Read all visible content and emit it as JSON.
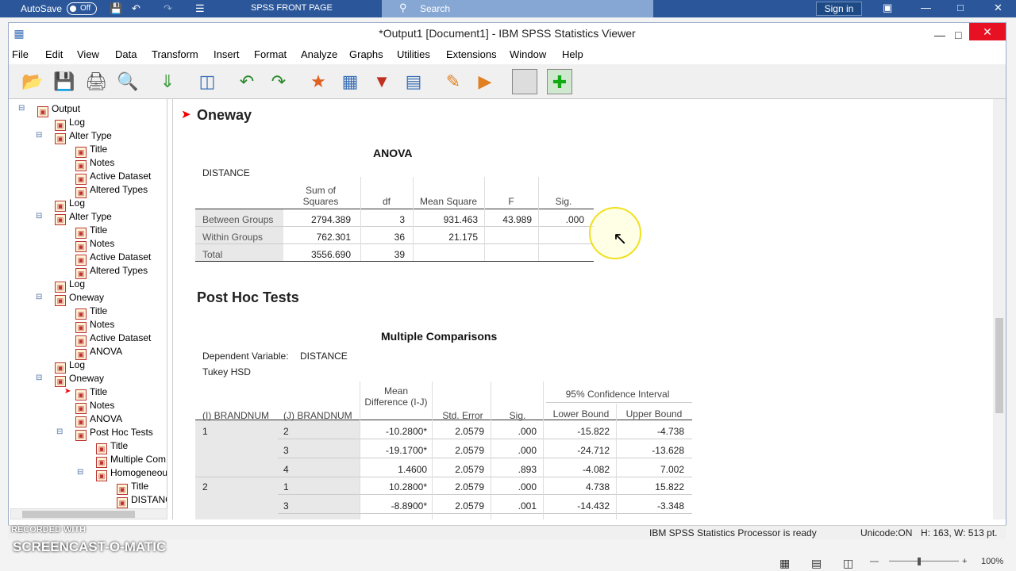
{
  "word": {
    "autosave": "AutoSave",
    "toggle": "Off",
    "doc_name": "SPSS FRONT PAGE",
    "search": "Search",
    "signin": "Sign in"
  },
  "window": {
    "title": "*Output1 [Document1] - IBM SPSS Statistics Viewer"
  },
  "menu": [
    "File",
    "Edit",
    "View",
    "Data",
    "Transform",
    "Insert",
    "Format",
    "Analyze",
    "Graphs",
    "Utilities",
    "Extensions",
    "Window",
    "Help"
  ],
  "outline": [
    {
      "label": "Output"
    },
    {
      "label": "Log"
    },
    {
      "label": "Alter Type"
    },
    {
      "label": "Title"
    },
    {
      "label": "Notes"
    },
    {
      "label": "Active Dataset"
    },
    {
      "label": "Altered Types"
    },
    {
      "label": "Log"
    },
    {
      "label": "Alter Type"
    },
    {
      "label": "Title"
    },
    {
      "label": "Notes"
    },
    {
      "label": "Active Dataset"
    },
    {
      "label": "Altered Types"
    },
    {
      "label": "Log"
    },
    {
      "label": "Oneway"
    },
    {
      "label": "Title"
    },
    {
      "label": "Notes"
    },
    {
      "label": "Active Dataset"
    },
    {
      "label": "ANOVA"
    },
    {
      "label": "Log"
    },
    {
      "label": "Oneway"
    },
    {
      "label": "Title"
    },
    {
      "label": "Notes"
    },
    {
      "label": "ANOVA"
    },
    {
      "label": "Post Hoc Tests"
    },
    {
      "label": "Title"
    },
    {
      "label": "Multiple Com"
    },
    {
      "label": "Homogeneou"
    },
    {
      "label": "Title"
    },
    {
      "label": "DISTANC"
    }
  ],
  "content": {
    "oneway": "Oneway",
    "anova_title": "ANOVA",
    "anova_var": "DISTANCE",
    "anova_headers": {
      "ss": "Sum of Squares",
      "df": "df",
      "ms": "Mean Square",
      "f": "F",
      "sig": "Sig."
    },
    "anova_rows": [
      {
        "label": "Between Groups",
        "ss": "2794.389",
        "df": "3",
        "ms": "931.463",
        "f": "43.989",
        "sig": ".000"
      },
      {
        "label": "Within Groups",
        "ss": "762.301",
        "df": "36",
        "ms": "21.175",
        "f": "",
        "sig": ""
      },
      {
        "label": "Total",
        "ss": "3556.690",
        "df": "39",
        "ms": "",
        "f": "",
        "sig": ""
      }
    ],
    "posthoc": "Post Hoc Tests",
    "mc_title": "Multiple Comparisons",
    "mc_depvar_label": "Dependent Variable:",
    "mc_depvar": "DISTANCE",
    "mc_method": "Tukey HSD",
    "mc_headers": {
      "i": "(I) BRANDNUM",
      "j": "(J) BRANDNUM",
      "md": "Mean Difference (I-J)",
      "se": "Std. Error",
      "sig": "Sig.",
      "ci": "95% Confidence Interval",
      "lb": "Lower Bound",
      "ub": "Upper Bound"
    },
    "mc_rows": [
      {
        "i": "1",
        "j": "2",
        "md": "-10.2800*",
        "se": "2.0579",
        "sig": ".000",
        "lb": "-15.822",
        "ub": "-4.738"
      },
      {
        "i": "",
        "j": "3",
        "md": "-19.1700*",
        "se": "2.0579",
        "sig": ".000",
        "lb": "-24.712",
        "ub": "-13.628"
      },
      {
        "i": "",
        "j": "4",
        "md": "1.4600",
        "se": "2.0579",
        "sig": ".893",
        "lb": "-4.082",
        "ub": "7.002"
      },
      {
        "i": "2",
        "j": "1",
        "md": "10.2800*",
        "se": "2.0579",
        "sig": ".000",
        "lb": "4.738",
        "ub": "15.822"
      },
      {
        "i": "",
        "j": "3",
        "md": "-8.8900*",
        "se": "2.0579",
        "sig": ".001",
        "lb": "-14.432",
        "ub": "-3.348"
      }
    ]
  },
  "status": {
    "processor": "IBM SPSS Statistics Processor is ready",
    "unicode": "Unicode:ON",
    "dims": "H: 163, W: 513 pt."
  },
  "watermark": {
    "recorded": "RECORDED WITH",
    "brand": "SCREENCAST-O-MATIC"
  },
  "zoom": "100%"
}
